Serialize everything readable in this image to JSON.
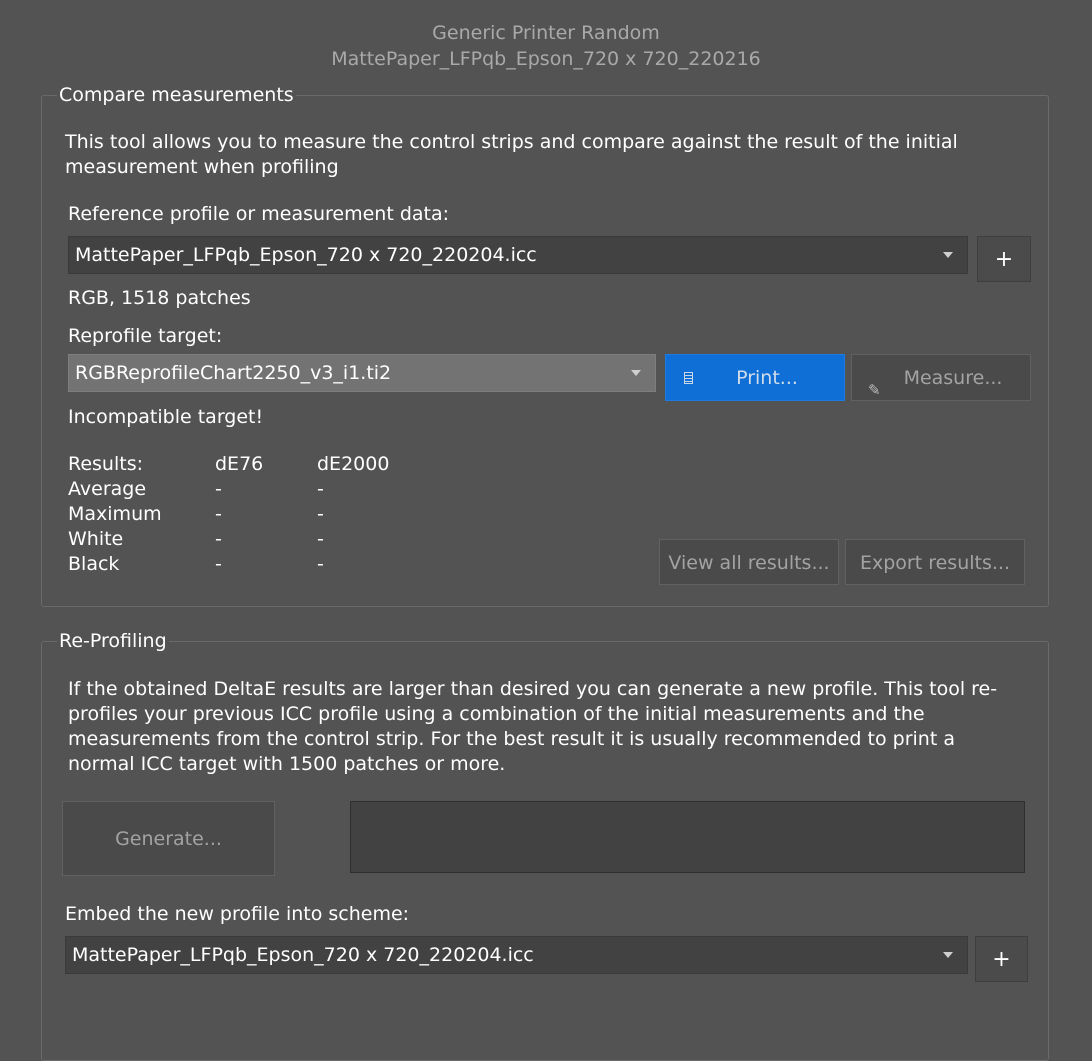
{
  "header": {
    "line1": "Generic Printer Random",
    "line2": "MattePaper_LFPqb_Epson_720 x 720_220216"
  },
  "compare": {
    "title": "Compare measurements",
    "description": "This tool allows you to measure the control strips and compare against the result of the initial measurement when profiling",
    "reference_label": "Reference profile or measurement data:",
    "reference_value": "MattePaper_LFPqb_Epson_720 x 720_220204.icc",
    "add_label": "+",
    "info": "RGB, 1518 patches",
    "target_label": "Reprofile target:",
    "target_value": "RGBReprofileChart2250_v3_i1.ti2",
    "print_label": "Print...",
    "measure_label": "Measure...",
    "warning": "Incompatible target!",
    "results": {
      "header": [
        "Results:",
        "dE76",
        "dE2000"
      ],
      "rows": [
        [
          "Average",
          "-",
          "-"
        ],
        [
          "Maximum",
          "-",
          "-"
        ],
        [
          "White",
          "-",
          "-"
        ],
        [
          "Black",
          "-",
          "-"
        ]
      ]
    },
    "view_all_label": "View all results...",
    "export_label": "Export results...",
    "colors": {
      "primary": "#0f6fd6"
    }
  },
  "reprofiling": {
    "title": "Re-Profiling",
    "description": "If the obtained DeltaE results are larger than desired you can generate a new profile. This tool re-profiles your previous ICC profile using a combination of the initial measurements and the measurements from the control strip. For the best result it is usually recommended to print a normal ICC target with 1500 patches or more.",
    "generate_label": "Generate...",
    "embed_label": "Embed the new profile into scheme:",
    "embed_value": "MattePaper_LFPqb_Epson_720 x 720_220204.icc",
    "add_label": "+"
  }
}
